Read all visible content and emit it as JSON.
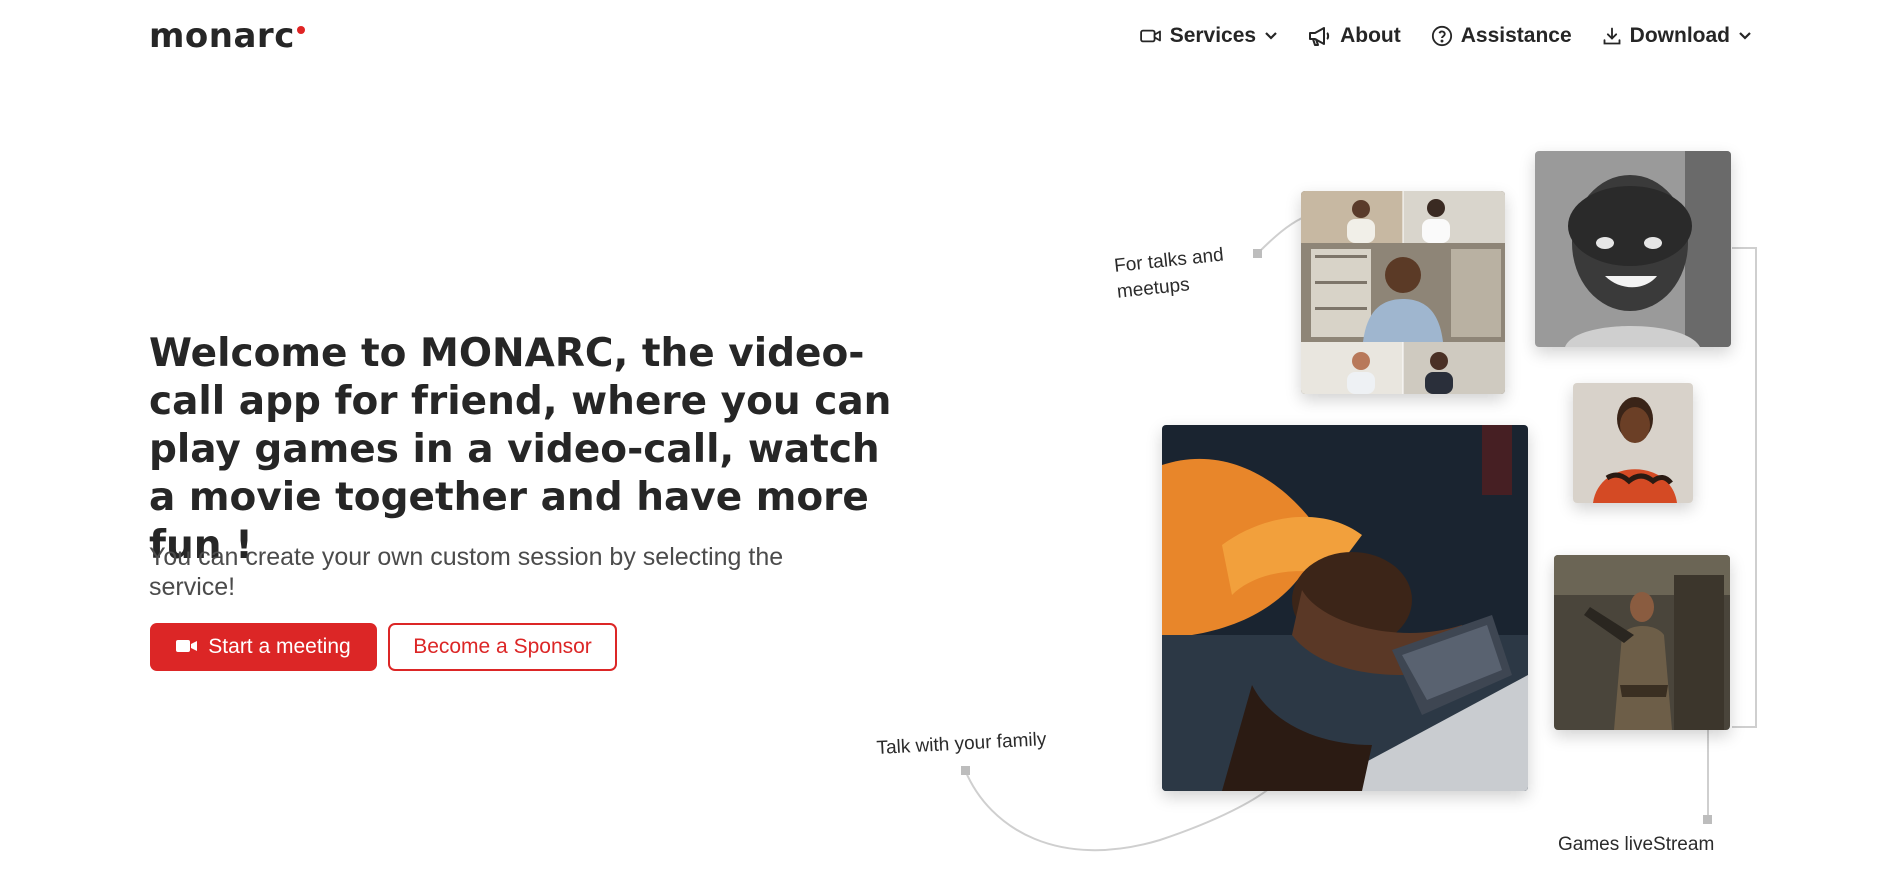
{
  "brand": {
    "name": "monarc",
    "dot_color": "#e02424"
  },
  "nav": {
    "services": "Services",
    "about": "About",
    "assistance": "Assistance",
    "download": "Download"
  },
  "hero": {
    "title": "Welcome to MONARC, the video-call app for friend, where you can play games in a video-call, watch a movie together and have more fun !",
    "subtitle": "You can create your own custom session by selecting the service!",
    "primary_button": "Start a meeting",
    "secondary_button": "Become a Sponsor",
    "accent_color": "#dc2626"
  },
  "gallery": {
    "label_talks": "For talks and meetups",
    "label_family": "Talk with your family",
    "label_games": "Games liveStream"
  },
  "icons": [
    "video-icon",
    "chevron-down-icon",
    "megaphone-icon",
    "help-circle-icon",
    "download-icon"
  ]
}
